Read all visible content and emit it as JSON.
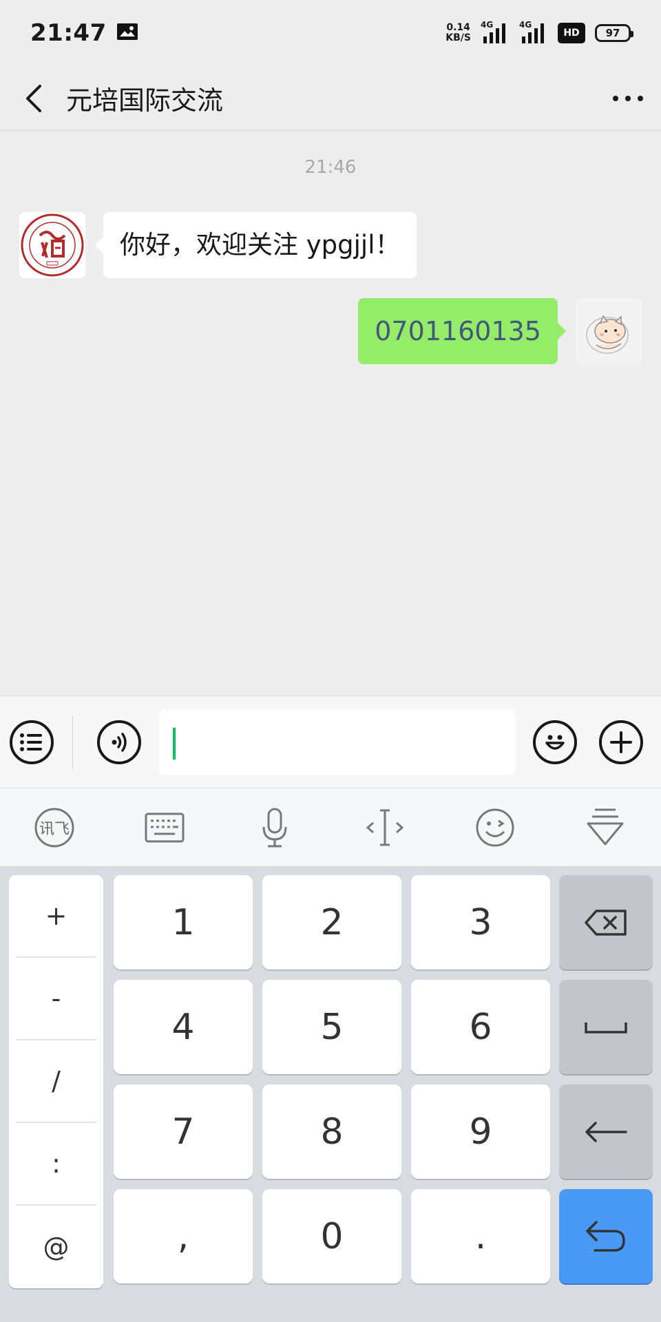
{
  "status_bar": {
    "time": "21:47",
    "net_speed_value": "0.14",
    "net_speed_unit": "KB/S",
    "signal_1_label": "4G",
    "signal_2_label": "4G",
    "hd_label": "HD",
    "battery": "97"
  },
  "header": {
    "title": "元培国际交流"
  },
  "chat": {
    "timestamp": "21:46",
    "messages": [
      {
        "direction": "in",
        "text": "你好，欢迎关注 ypgjjl！"
      },
      {
        "direction": "out",
        "text": "0701160135"
      }
    ]
  },
  "input_bar": {
    "value": ""
  },
  "ime_toolbar": {
    "tools": [
      "xunfei-logo-icon",
      "keyboard-icon",
      "microphone-icon",
      "cursor-move-icon",
      "emoji-wink-icon",
      "collapse-keyboard-icon"
    ],
    "logo_text": "讯飞"
  },
  "keyboard": {
    "symbols": [
      "+",
      "-",
      "/",
      ":",
      "@"
    ],
    "keys": [
      [
        "1",
        "2",
        "3"
      ],
      [
        "4",
        "5",
        "6"
      ],
      [
        "7",
        "8",
        "9"
      ],
      [
        ",",
        "0",
        "."
      ]
    ]
  },
  "colors": {
    "background": "#ededed",
    "bubble_out": "#95ec69",
    "bubble_in": "#ffffff",
    "enter_key": "#4a9af5",
    "caret": "#07c160"
  }
}
